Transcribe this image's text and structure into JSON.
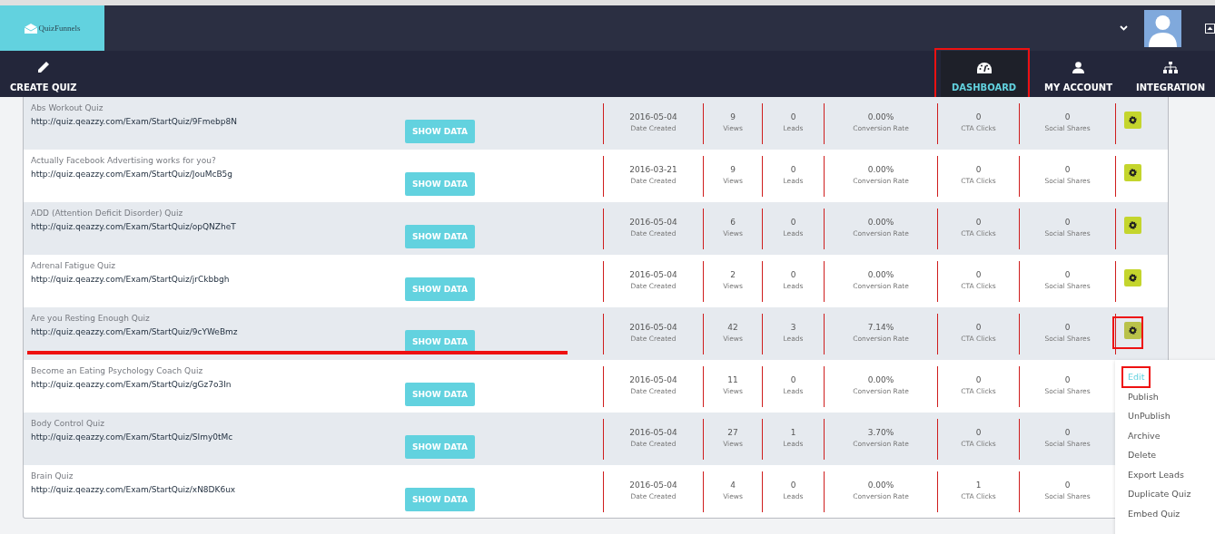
{
  "logo": {
    "text": "QuizFunnels"
  },
  "nav_left": {
    "label": "CREATE QUIZ"
  },
  "nav": [
    {
      "label": "DASHBOARD",
      "selected": true,
      "highlighted": true,
      "kind": "gauge"
    },
    {
      "label": "MY ACCOUNT",
      "selected": false,
      "highlighted": false,
      "kind": "user"
    },
    {
      "label": "INTEGRATION",
      "selected": false,
      "highlighted": false,
      "kind": "sitemap"
    }
  ],
  "rows": [
    {
      "name": "Abs Workout Quiz",
      "url": "http://quiz.qeazzy.com/Exam/StartQuiz/9Fmebp8N",
      "button": "SHOW DATA",
      "underlined": false,
      "gear": {
        "highlighted": false
      },
      "stats": [
        {
          "value": "2016-05-04",
          "label": "Date Created"
        },
        {
          "value": "9",
          "label": "Views"
        },
        {
          "value": "0",
          "label": "Leads"
        },
        {
          "value": "0.00%",
          "label": "Conversion Rate"
        },
        {
          "value": "0",
          "label": "CTA Clicks"
        },
        {
          "value": "0",
          "label": "Social Shares"
        }
      ]
    },
    {
      "name": "Actually Facebook Advertising works for you?",
      "url": "http://quiz.qeazzy.com/Exam/StartQuiz/JouMcB5g",
      "button": "SHOW DATA",
      "underlined": false,
      "gear": {
        "highlighted": false
      },
      "stats": [
        {
          "value": "2016-03-21",
          "label": "Date Created"
        },
        {
          "value": "9",
          "label": "Views"
        },
        {
          "value": "0",
          "label": "Leads"
        },
        {
          "value": "0.00%",
          "label": "Conversion Rate"
        },
        {
          "value": "0",
          "label": "CTA Clicks"
        },
        {
          "value": "0",
          "label": "Social Shares"
        }
      ]
    },
    {
      "name": "ADD (Attention Deficit Disorder) Quiz",
      "url": "http://quiz.qeazzy.com/Exam/StartQuiz/opQNZheT",
      "button": "SHOW DATA",
      "underlined": false,
      "gear": {
        "highlighted": false
      },
      "stats": [
        {
          "value": "2016-05-04",
          "label": "Date Created"
        },
        {
          "value": "6",
          "label": "Views"
        },
        {
          "value": "0",
          "label": "Leads"
        },
        {
          "value": "0.00%",
          "label": "Conversion Rate"
        },
        {
          "value": "0",
          "label": "CTA Clicks"
        },
        {
          "value": "0",
          "label": "Social Shares"
        }
      ]
    },
    {
      "name": "Adrenal Fatigue Quiz",
      "url": "http://quiz.qeazzy.com/Exam/StartQuiz/jrCkbbgh",
      "button": "SHOW DATA",
      "underlined": false,
      "gear": {
        "highlighted": false
      },
      "stats": [
        {
          "value": "2016-05-04",
          "label": "Date Created"
        },
        {
          "value": "2",
          "label": "Views"
        },
        {
          "value": "0",
          "label": "Leads"
        },
        {
          "value": "0.00%",
          "label": "Conversion Rate"
        },
        {
          "value": "0",
          "label": "CTA Clicks"
        },
        {
          "value": "0",
          "label": "Social Shares"
        }
      ]
    },
    {
      "name": "Are you Resting Enough Quiz",
      "url": "http://quiz.qeazzy.com/Exam/StartQuiz/9cYWeBmz",
      "button": "SHOW DATA",
      "underlined": true,
      "gear": {
        "highlighted": true
      },
      "stats": [
        {
          "value": "2016-05-04",
          "label": "Date Created"
        },
        {
          "value": "42",
          "label": "Views"
        },
        {
          "value": "3",
          "label": "Leads"
        },
        {
          "value": "7.14%",
          "label": "Conversion Rate"
        },
        {
          "value": "0",
          "label": "CTA Clicks"
        },
        {
          "value": "0",
          "label": "Social Shares"
        }
      ]
    },
    {
      "name": "Become an Eating Psychology Coach Quiz",
      "url": "http://quiz.qeazzy.com/Exam/StartQuiz/gGz7o3In",
      "button": "SHOW DATA",
      "underlined": false,
      "stats": [
        {
          "value": "2016-05-04",
          "label": "Date Created"
        },
        {
          "value": "11",
          "label": "Views"
        },
        {
          "value": "0",
          "label": "Leads"
        },
        {
          "value": "0.00%",
          "label": "Conversion Rate"
        },
        {
          "value": "0",
          "label": "CTA Clicks"
        },
        {
          "value": "0",
          "label": "Social Shares"
        }
      ]
    },
    {
      "name": "Body Control Quiz",
      "url": "http://quiz.qeazzy.com/Exam/StartQuiz/SImy0tMc",
      "button": "SHOW DATA",
      "underlined": false,
      "stats": [
        {
          "value": "2016-05-04",
          "label": "Date Created"
        },
        {
          "value": "27",
          "label": "Views"
        },
        {
          "value": "1",
          "label": "Leads"
        },
        {
          "value": "3.70%",
          "label": "Conversion Rate"
        },
        {
          "value": "0",
          "label": "CTA Clicks"
        },
        {
          "value": "0",
          "label": "Social Shares"
        }
      ]
    },
    {
      "name": "Brain Quiz",
      "url": "http://quiz.qeazzy.com/Exam/StartQuiz/xN8DK6ux",
      "button": "SHOW DATA",
      "underlined": false,
      "stats": [
        {
          "value": "2016-05-04",
          "label": "Date Created"
        },
        {
          "value": "4",
          "label": "Views"
        },
        {
          "value": "0",
          "label": "Leads"
        },
        {
          "value": "0.00%",
          "label": "Conversion Rate"
        },
        {
          "value": "1",
          "label": "CTA Clicks"
        },
        {
          "value": "0",
          "label": "Social Shares"
        }
      ]
    }
  ],
  "menu": [
    {
      "label": "Edit",
      "selected": true,
      "highlighted": true
    },
    {
      "label": "Publish",
      "selected": false,
      "highlighted": false
    },
    {
      "label": "UnPublish",
      "selected": false,
      "highlighted": false
    },
    {
      "label": "Archive",
      "selected": false,
      "highlighted": false
    },
    {
      "label": "Delete",
      "selected": false,
      "highlighted": false
    },
    {
      "label": "Export Leads",
      "selected": false,
      "highlighted": false
    },
    {
      "label": "Duplicate Quiz",
      "selected": false,
      "highlighted": false
    },
    {
      "label": "Embed Quiz",
      "selected": false,
      "highlighted": false
    }
  ]
}
